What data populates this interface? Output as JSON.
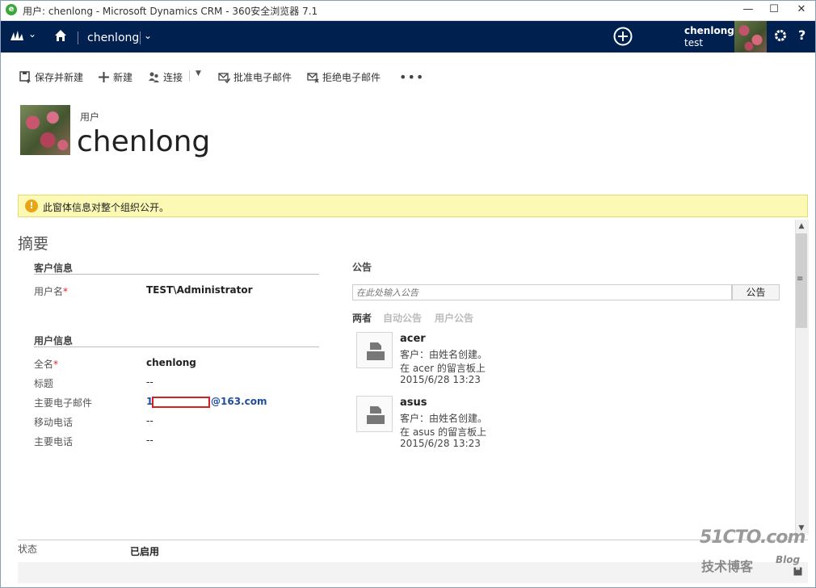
{
  "window": {
    "title": "用户: chenlong - Microsoft Dynamics CRM - 360安全浏览器 7.1",
    "browser_icon": "e",
    "min": "—",
    "max": "☐",
    "close": "✕"
  },
  "nav": {
    "entity": "chenlong",
    "user_name": "chenlong",
    "user_org": "test",
    "help": "?"
  },
  "commands": {
    "save_new": "保存并新建",
    "new": "新建",
    "connect": "连接",
    "approve_email": "批准电子邮件",
    "reject_email": "拒绝电子邮件",
    "more": "•••"
  },
  "header": {
    "record_type": "用户",
    "record_name": "chenlong"
  },
  "notification": {
    "text": "此窗体信息对整个组织公开。",
    "icon": "!"
  },
  "summary": {
    "title": "摘要",
    "account_section": {
      "header": "客户信息",
      "username_label": "用户名",
      "username_value": "TEST\\Administrator"
    },
    "user_section": {
      "header": "用户信息",
      "fields": [
        {
          "label": "全名",
          "required": true,
          "value": "chenlong",
          "bold": true
        },
        {
          "label": "标题",
          "value": "--"
        },
        {
          "label": "主要电子邮件",
          "value_prefix": "1",
          "value_suffix": "@163.com"
        },
        {
          "label": "移动电话",
          "value": "--"
        },
        {
          "label": "主要电话",
          "value": "--"
        }
      ]
    },
    "required_mark": "*"
  },
  "posts": {
    "title": "公告",
    "input_placeholder": "在此处输入公告",
    "post_button": "公告",
    "filters": [
      "两者",
      "自动公告",
      "用户公告"
    ],
    "items": [
      {
        "title": "acer",
        "line1": "客户：由姓名创建。",
        "line2": "在 acer 的留言板上",
        "time": "2015/6/28 13:23"
      },
      {
        "title": "asus",
        "line1": "客户：由姓名创建。",
        "line2": "在 asus 的留言板上",
        "time": "2015/6/28 13:23"
      }
    ]
  },
  "footer": {
    "status_label": "状态",
    "status_value": "已启用"
  },
  "watermark": {
    "main": "51CTO.com",
    "sub": "技术博客",
    "blog": "Blog"
  },
  "colors": {
    "navbar": "#002050",
    "notification_bg": "#fbf9b4",
    "link": "#1f4e9e",
    "required": "#d22"
  }
}
